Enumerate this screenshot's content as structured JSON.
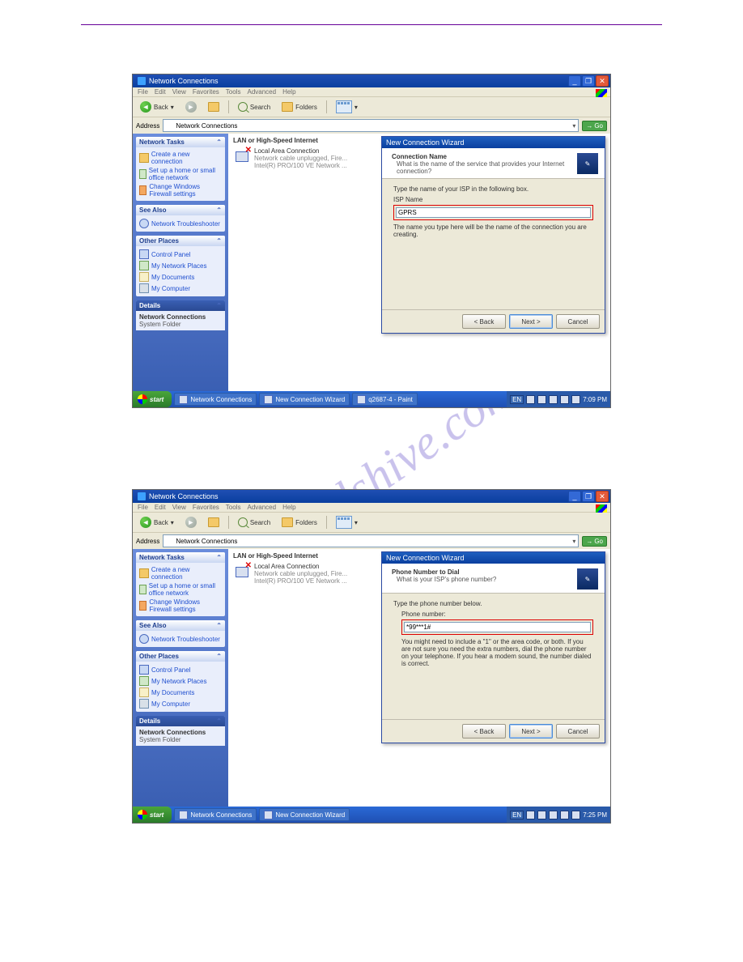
{
  "watermark": "manualshive.com",
  "s1": {
    "window_title": "Network Connections",
    "menus": [
      "File",
      "Edit",
      "View",
      "Favorites",
      "Tools",
      "Advanced",
      "Help"
    ],
    "toolbar": {
      "back": "Back",
      "search": "Search",
      "folders": "Folders"
    },
    "address_label": "Address",
    "address_value": "Network Connections",
    "go": "Go",
    "content_heading": "LAN or High-Speed Internet",
    "lan_title": "Local Area Connection",
    "lan_sub1": "Network cable unplugged, Fire...",
    "lan_sub2": "Intel(R) PRO/100 VE Network ...",
    "sidebar": {
      "tasks_hd": "Network Tasks",
      "tasks": [
        "Create a new connection",
        "Set up a home or small office network",
        "Change Windows Firewall settings"
      ],
      "see_hd": "See Also",
      "see": [
        "Network Troubleshooter"
      ],
      "places_hd": "Other Places",
      "places": [
        "Control Panel",
        "My Network Places",
        "My Documents",
        "My Computer"
      ],
      "details_hd": "Details",
      "details_title": "Network Connections",
      "details_sub": "System Folder"
    },
    "wizard": {
      "title": "New Connection Wizard",
      "hdr_title": "Connection Name",
      "hdr_sub": "What is the name of the service that provides your Internet connection?",
      "body_instr": "Type the name of your ISP in the following box.",
      "field_label": "ISP Name",
      "field_value": "GPRS",
      "note": "The name you type here will be the name of the connection you are creating.",
      "back": "< Back",
      "next": "Next >",
      "cancel": "Cancel"
    },
    "taskbar": {
      "start": "start",
      "tasks": [
        "Network Connections",
        "New Connection Wizard",
        "q2687-4 - Paint"
      ],
      "lang": "EN",
      "clock": "7:09 PM"
    }
  },
  "s2": {
    "window_title": "Network Connections",
    "menus": [
      "File",
      "Edit",
      "View",
      "Favorites",
      "Tools",
      "Advanced",
      "Help"
    ],
    "toolbar": {
      "back": "Back",
      "search": "Search",
      "folders": "Folders"
    },
    "address_label": "Address",
    "address_value": "Network Connections",
    "go": "Go",
    "content_heading": "LAN or High-Speed Internet",
    "lan_title": "Local Area Connection",
    "lan_sub1": "Network cable unplugged, Fire...",
    "lan_sub2": "Intel(R) PRO/100 VE Network ...",
    "sidebar": {
      "tasks_hd": "Network Tasks",
      "tasks": [
        "Create a new connection",
        "Set up a home or small office network",
        "Change Windows Firewall settings"
      ],
      "see_hd": "See Also",
      "see": [
        "Network Troubleshooter"
      ],
      "places_hd": "Other Places",
      "places": [
        "Control Panel",
        "My Network Places",
        "My Documents",
        "My Computer"
      ],
      "details_hd": "Details",
      "details_title": "Network Connections",
      "details_sub": "System Folder"
    },
    "wizard": {
      "title": "New Connection Wizard",
      "hdr_title": "Phone Number to Dial",
      "hdr_sub": "What is your ISP's phone number?",
      "body_instr": "Type the phone number below.",
      "field_label": "Phone number:",
      "field_value": "*99***1#",
      "note": "You might need to include a \"1\" or the area code, or both. If you are not sure you need the extra numbers, dial the phone number on your telephone. If you hear a modem sound, the number dialed is correct.",
      "back": "< Back",
      "next": "Next >",
      "cancel": "Cancel"
    },
    "taskbar": {
      "start": "start",
      "tasks": [
        "Network Connections",
        "New Connection Wizard"
      ],
      "lang": "EN",
      "clock": "7:25 PM"
    }
  }
}
